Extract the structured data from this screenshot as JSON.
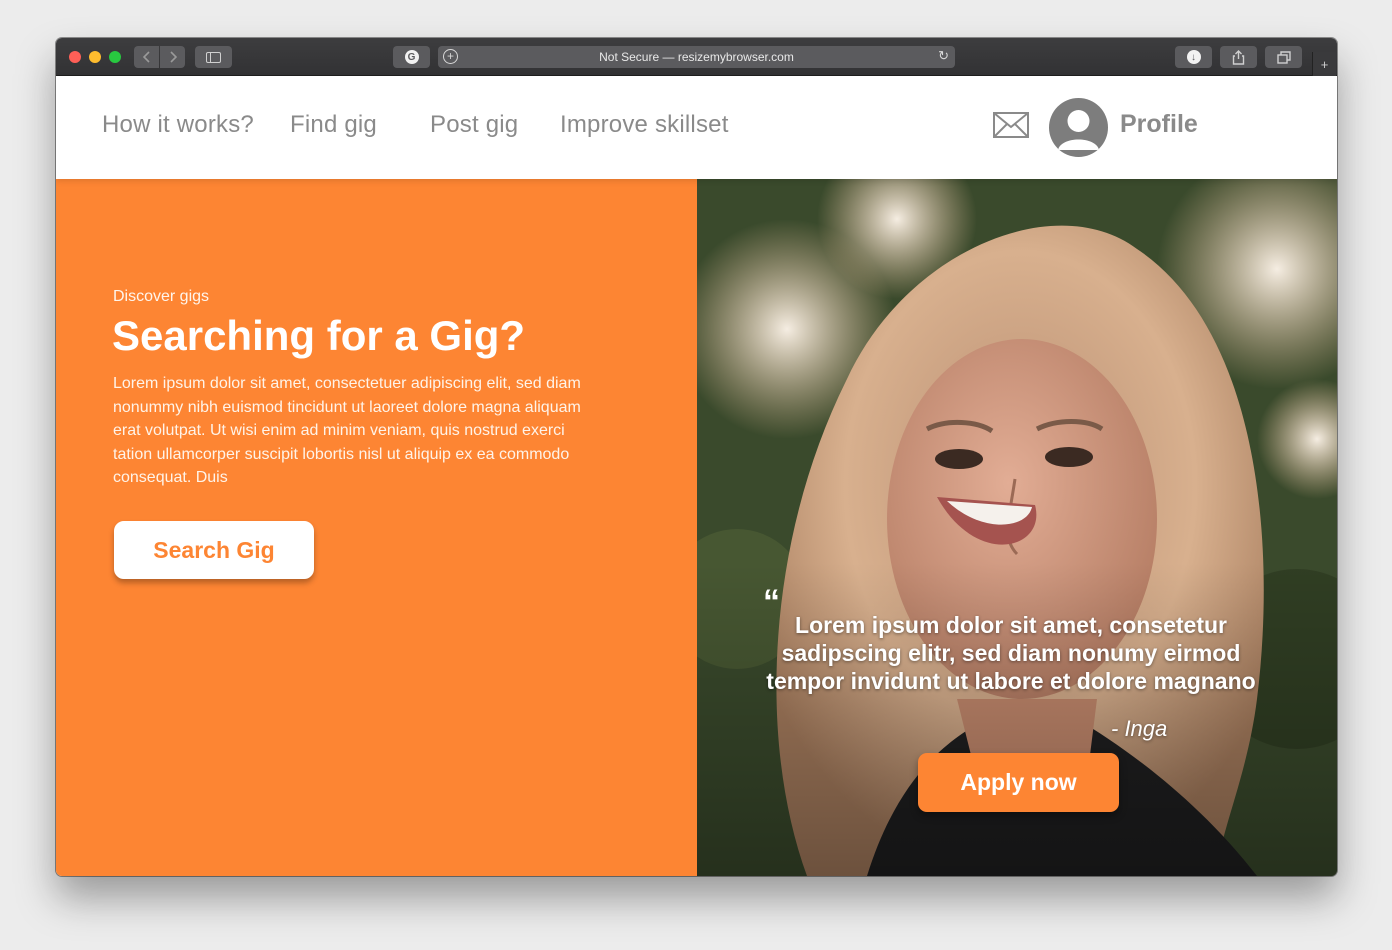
{
  "browser": {
    "url_text": "Not Secure — resizemybrowser.com",
    "new_tab_symbol": "+",
    "icons": [
      "back-chevron-icon",
      "forward-chevron-icon",
      "sidebar-icon",
      "grammarly-icon",
      "add-icon",
      "reload-icon",
      "download-icon",
      "share-icon",
      "tabs-icon",
      "new-tab-icon"
    ]
  },
  "nav": {
    "links": [
      "How it works?",
      "Find gig",
      "Post gig",
      "Improve skillset"
    ],
    "profile_label": "Profile",
    "icons": [
      "mail-icon",
      "avatar"
    ]
  },
  "hero": {
    "eyebrow": "Discover gigs",
    "title": "Searching for a Gig?",
    "body": "Lorem ipsum dolor sit amet, consectetuer adipiscing elit, sed diam nonummy nibh euismod tincidunt ut laoreet dolore magna aliquam erat volutpat. Ut wisi enim ad minim veniam, quis nostrud exerci tation ullamcorper suscipit lobortis nisl ut aliquip ex ea commodo consequat. Duis",
    "search_button": "Search Gig"
  },
  "testimonial": {
    "quote_mark": "“",
    "quote": "Lorem ipsum dolor sit amet, consetetur sadipscing elitr, sed diam nonumy eirmod tempor invidunt ut labore et dolore magnano",
    "author": "- Inga",
    "apply_button": "Apply now"
  },
  "colors": {
    "accent": "#fd8533",
    "nav_text": "#8a8a8a",
    "chrome": "#3d3d3f"
  }
}
